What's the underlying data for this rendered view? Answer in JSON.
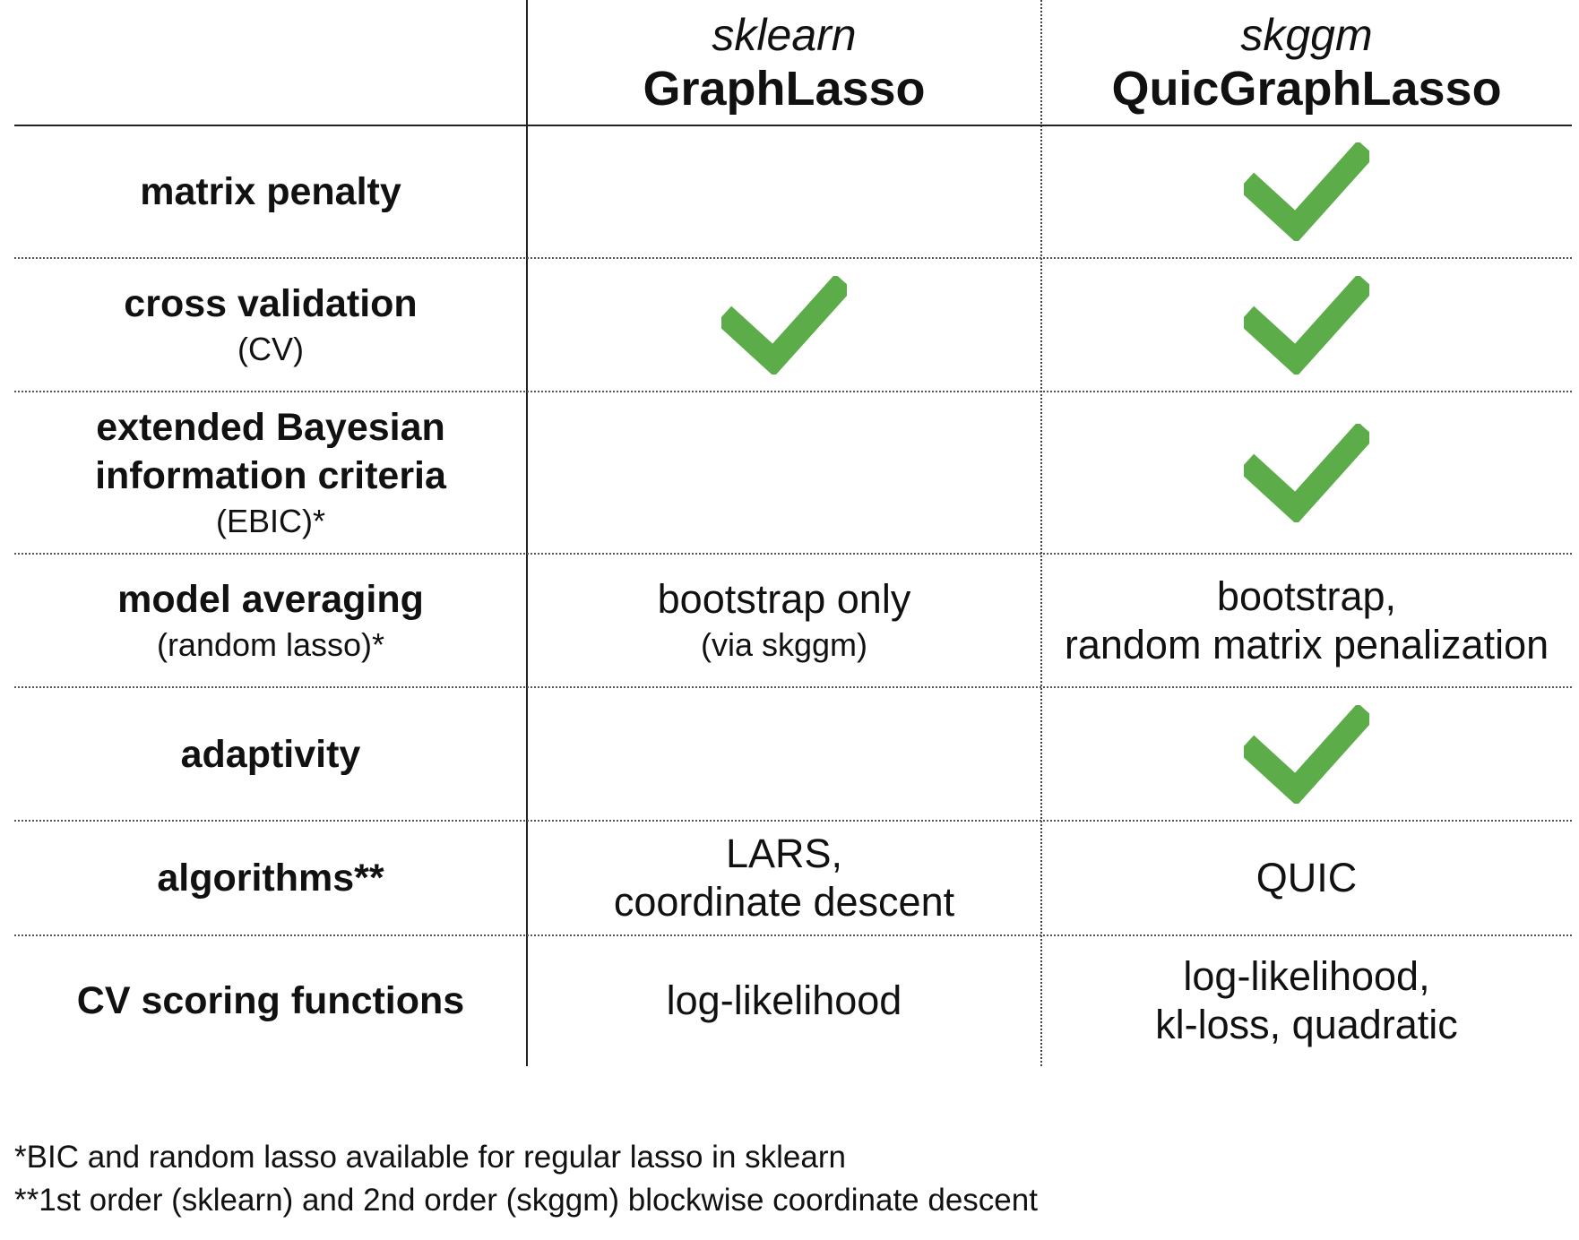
{
  "columns": [
    {
      "library": "sklearn",
      "class_name": "GraphLasso"
    },
    {
      "library": "skggm",
      "class_name": "QuicGraphLasso"
    }
  ],
  "check_color": "#5cad4a",
  "check_icon": "green-check-mark",
  "rows": [
    {
      "feature": [
        "matrix penalty"
      ],
      "sub": "",
      "sklearn": {
        "check": false,
        "lines": [],
        "sub": ""
      },
      "skggm": {
        "check": true,
        "lines": [],
        "sub": ""
      }
    },
    {
      "feature": [
        "cross validation"
      ],
      "sub": "(CV)",
      "sklearn": {
        "check": true,
        "lines": [],
        "sub": ""
      },
      "skggm": {
        "check": true,
        "lines": [],
        "sub": ""
      }
    },
    {
      "feature": [
        "extended Bayesian",
        "information criteria"
      ],
      "sub": "(EBIC)*",
      "sklearn": {
        "check": false,
        "lines": [],
        "sub": ""
      },
      "skggm": {
        "check": true,
        "lines": [],
        "sub": ""
      }
    },
    {
      "feature": [
        "model averaging"
      ],
      "sub": "(random lasso)*",
      "sklearn": {
        "check": false,
        "lines": [
          "bootstrap only"
        ],
        "sub": "(via skggm)"
      },
      "skggm": {
        "check": false,
        "lines": [
          "bootstrap,",
          "random matrix penalization"
        ],
        "sub": ""
      }
    },
    {
      "feature": [
        "adaptivity"
      ],
      "sub": "",
      "sklearn": {
        "check": false,
        "lines": [],
        "sub": ""
      },
      "skggm": {
        "check": true,
        "lines": [],
        "sub": ""
      }
    },
    {
      "feature": [
        "algorithms**"
      ],
      "sub": "",
      "sklearn": {
        "check": false,
        "lines": [
          "LARS,",
          "coordinate descent"
        ],
        "sub": ""
      },
      "skggm": {
        "check": false,
        "lines": [
          "QUIC"
        ],
        "sub": ""
      }
    },
    {
      "feature": [
        "CV scoring functions"
      ],
      "sub": "",
      "sklearn": {
        "check": false,
        "lines": [
          "log-likelihood"
        ],
        "sub": ""
      },
      "skggm": {
        "check": false,
        "lines": [
          "log-likelihood,",
          "kl-loss, quadratic"
        ],
        "sub": ""
      }
    }
  ],
  "footnotes": [
    "*BIC and random lasso available for regular lasso in sklearn",
    "**1st order (sklearn) and 2nd order (skggm) blockwise coordinate descent"
  ]
}
